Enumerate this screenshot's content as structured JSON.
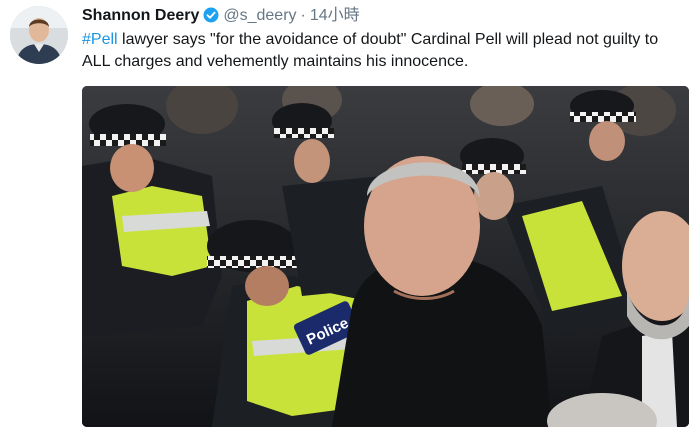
{
  "tweet": {
    "author": {
      "display_name": "Shannon Deery",
      "handle": "@s_deery",
      "verified_icon": "verified-badge-icon"
    },
    "separator": "·",
    "time": "14小時",
    "text": {
      "hashtag": "#Pell",
      "body_line1": " lawyer says \"for the avoidance of doubt\" Cardinal Pell will plead not guilty to",
      "body_line2": "ALL charges and vehemently maintains his innocence."
    },
    "photo": {
      "vest_text": "Police"
    },
    "colors": {
      "link": "#1b95e0",
      "verified": "#1da1f2",
      "muted": "#657786",
      "hi_vis": "#c9e23a"
    }
  }
}
